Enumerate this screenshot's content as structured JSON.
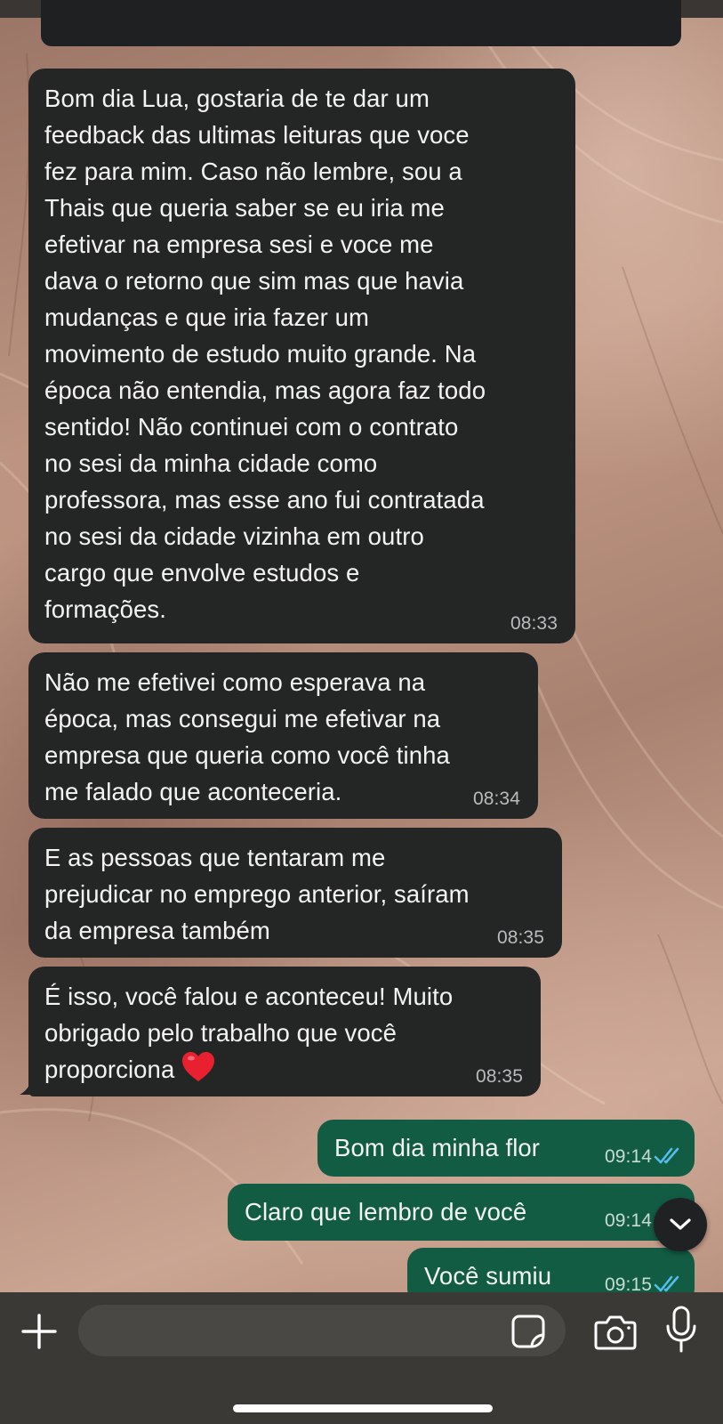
{
  "header": {},
  "messages": [
    {
      "direction": "incoming",
      "text": "Bom dia Lua, gostaria de te dar um\nfeedback das ultimas leituras que voce\nfez para mim. Caso não lembre, sou a\nThais que queria saber se eu iria me\nefetivar na empresa sesi e voce me\ndava o retorno que sim mas que havia\nmudanças e que iria fazer um\nmovimento de estudo muito grande. Na\népoca não entendia, mas agora faz todo\nsentido! Não continuei com o contrato\nno sesi da minha cidade como\nprofessora, mas esse ano fui contratada\nno sesi da cidade vizinha em outro\ncargo que envolve estudos e\nformações.",
      "time": "08:33"
    },
    {
      "direction": "incoming",
      "text": "Não me efetivei como esperava na\népoca, mas consegui me efetivar na\nempresa que queria como você tinha\nme falado que aconteceria.",
      "time": "08:34"
    },
    {
      "direction": "incoming",
      "text": "E as pessoas que tentaram me\nprejudicar no emprego anterior, saíram\nda empresa também",
      "time": "08:35"
    },
    {
      "direction": "incoming",
      "text": "É isso, você falou e aconteceu! Muito\nobrigado pelo trabalho que você\nproporciona",
      "time": "08:35",
      "emoji": "red-heart"
    },
    {
      "direction": "outgoing",
      "text": "Bom dia minha flor",
      "time": "09:14",
      "status": "read"
    },
    {
      "direction": "outgoing",
      "text": "Claro que lembro de você",
      "time": "09:14",
      "status": "read"
    },
    {
      "direction": "outgoing",
      "text": "Você sumiu",
      "time": "09:15",
      "status": "read"
    }
  ],
  "composer": {
    "placeholder": "",
    "icons": [
      "plus-icon",
      "sticker-icon",
      "camera-icon",
      "microphone-icon"
    ]
  },
  "scroll_button": {
    "icon": "chevron-down-icon"
  },
  "colors": {
    "incoming_bubble": "#242626",
    "outgoing_bubble": "#135c44",
    "read_ticks": "#53bdeb",
    "composer_bar": "#3b3936"
  }
}
